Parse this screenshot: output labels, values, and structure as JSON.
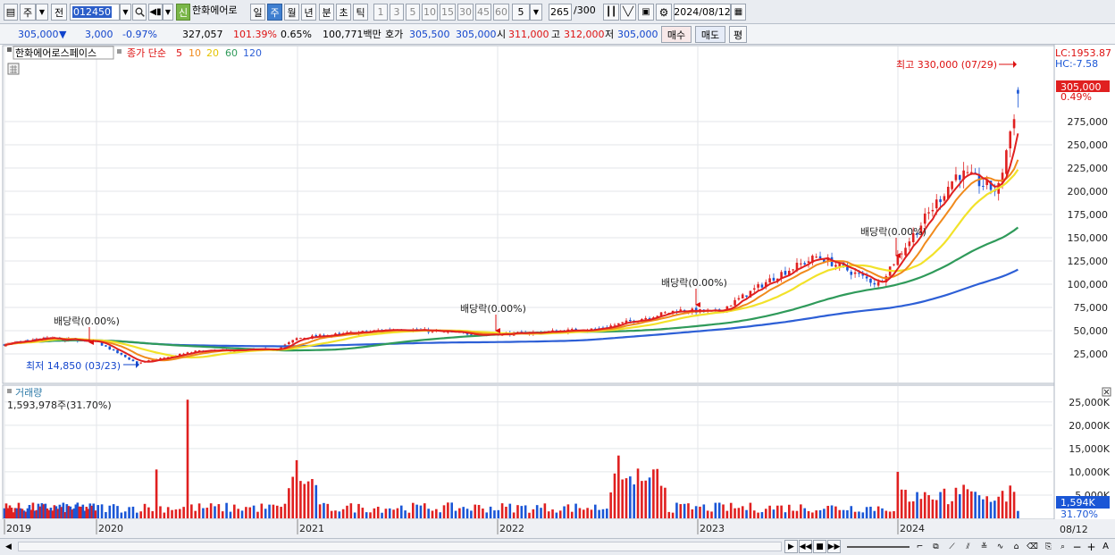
{
  "toolbar": {
    "period_type": "주",
    "prev_label": "전",
    "stock_code": "012450",
    "new_badge": "신",
    "stock_name": "한화에어로",
    "period_buttons": [
      "일",
      "주",
      "월",
      "년",
      "분",
      "초",
      "틱"
    ],
    "active_period": "주",
    "interval_buttons": [
      "1",
      "3",
      "5",
      "10",
      "15",
      "30",
      "45",
      "60"
    ],
    "interval_value": "5",
    "count_value": "265",
    "count_total": "/300",
    "date_value": "2024/08/12"
  },
  "info": {
    "price": "305,000",
    "change_arrow": "▼",
    "change": "3,000",
    "change_pct": "-0.97%",
    "volume": "327,057",
    "volume_ratio": "101.39%",
    "turnover": "0.65%",
    "amount": "100,771백만",
    "ask_label": "호가",
    "ask1": "305,500",
    "ask2": "305,000",
    "open_label": "시",
    "open": "311,000",
    "high_label": "고",
    "high": "312,000",
    "low_label": "저",
    "low": "305,000",
    "buy_label": "매수",
    "sell_label": "매도",
    "flat_label": "평"
  },
  "legend": {
    "name": "한화에어로스페이스",
    "ma_label": "종가 단순",
    "ma_periods": [
      "5",
      "10",
      "20",
      "60",
      "120"
    ]
  },
  "price_panel": {
    "lc": "LC:1953.87",
    "hc": "HC:-7.58",
    "current_tag": "305,000",
    "current_pct": "0.49%",
    "high_annotation": "최고 330,000 (07/29)",
    "low_annotation": "최저 14,850 (03/23)",
    "dividend_label": "배당락(0.00%)"
  },
  "volume_panel": {
    "title": "거래량",
    "value": "1,593,978주(31.70%)",
    "current_tag": "1,594K",
    "current_pct": "31.70%"
  },
  "axis": {
    "bottom_right_date": "08/12"
  },
  "colors": {
    "up": "#e02020",
    "down": "#1a56d6",
    "ma5": "#e02020",
    "ma10": "#f08a1c",
    "ma20": "#f2e22a",
    "ma60": "#2f9a5a",
    "ma120": "#2d5fd6"
  },
  "chart_data": [
    {
      "type": "line",
      "title": "한화에어로스페이스 주봉",
      "x_labels": [
        "2019",
        "2020",
        "2021",
        "2022",
        "2023",
        "2024"
      ],
      "y_ticks": [
        25000,
        50000,
        75000,
        100000,
        125000,
        150000,
        175000,
        200000,
        225000,
        250000,
        275000
      ],
      "ylim": [
        0,
        330000
      ],
      "series": [
        {
          "name": "종가",
          "x": [
            "2019",
            "2019.5",
            "2020",
            "2020.2",
            "2020.5",
            "2020.9",
            "2021",
            "2021.5",
            "2021.9",
            "2022.1",
            "2022.5",
            "2022.9",
            "2023.1",
            "2023.4",
            "2023.6",
            "2023.9",
            "2024",
            "2024.3",
            "2024.5",
            "2024.6"
          ],
          "values": [
            35000,
            42000,
            38000,
            15000,
            28000,
            30000,
            42000,
            52000,
            46000,
            47000,
            52000,
            72000,
            70000,
            110000,
            130000,
            100000,
            130000,
            220000,
            200000,
            305000
          ]
        },
        {
          "name": "120",
          "x": [
            "2019",
            "2020",
            "2021",
            "2022",
            "2023",
            "2024",
            "2024.6"
          ],
          "values": [
            29000,
            29000,
            30000,
            40000,
            50000,
            85000,
            125000
          ]
        }
      ],
      "annotations": [
        {
          "text": "최고 330,000 (07/29)",
          "value": 330000
        },
        {
          "text": "최저 14,850 (03/23)",
          "value": 14850
        },
        {
          "text": "배당락(0.00%)",
          "x": "2019.9"
        },
        {
          "text": "배당락(0.00%)",
          "x": "2022"
        },
        {
          "text": "배당락(0.00%)",
          "x": "2023"
        },
        {
          "text": "배당락(0.00%)",
          "x": "2024"
        }
      ]
    },
    {
      "type": "bar",
      "title": "거래량",
      "y_ticks": [
        5000,
        10000,
        15000,
        20000,
        25000
      ],
      "y_tick_labels": [
        "5,000K",
        "10,000K",
        "15,000K",
        "20,000K",
        "25,000K"
      ],
      "ylim": [
        0,
        26000
      ],
      "peaks": [
        {
          "x": "2020.3",
          "value": 10500
        },
        {
          "x": "2020.45",
          "value": 25500
        },
        {
          "x": "2021",
          "value": 12500
        },
        {
          "x": "2022.6",
          "value": 13500
        },
        {
          "x": "2024",
          "value": 10000
        }
      ],
      "current": 1594
    }
  ]
}
